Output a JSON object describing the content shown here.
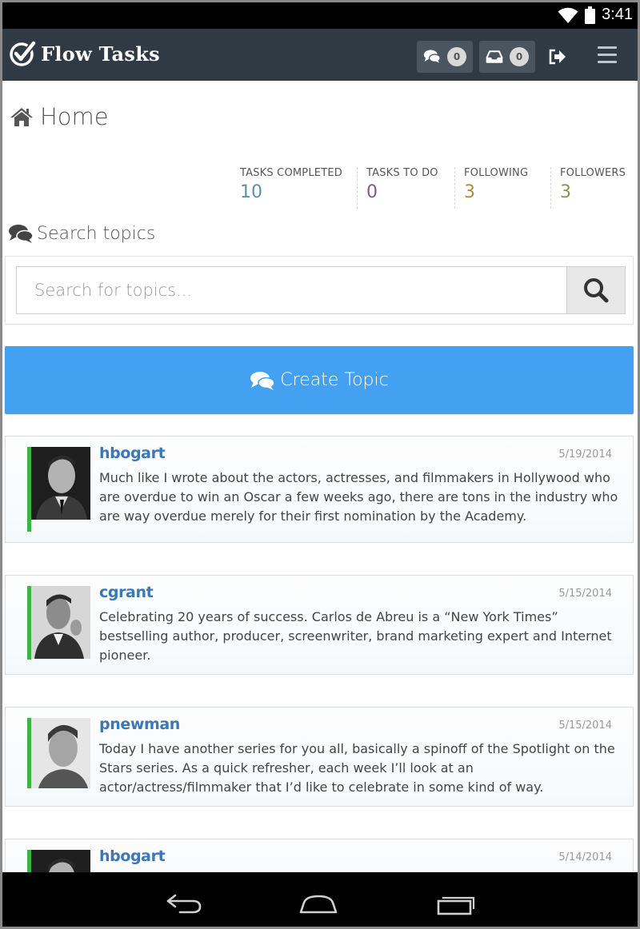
{
  "status_bar": {
    "time": "3:41"
  },
  "app": {
    "name": "Flow Tasks",
    "messages_count": "0",
    "inbox_count": "0"
  },
  "page": {
    "title": "Home"
  },
  "stats": [
    {
      "label": "TASKS COMPLETED",
      "value": "10",
      "color": "#5b8fa8"
    },
    {
      "label": "TASKS TO DO",
      "value": "0",
      "color": "#7a5d8f"
    },
    {
      "label": "FOLLOWING",
      "value": "3",
      "color": "#b08a3e"
    },
    {
      "label": "FOLLOWERS",
      "value": "3",
      "color": "#7f9a4e"
    }
  ],
  "search": {
    "section_title": "Search topics",
    "placeholder": "Search for topics..."
  },
  "create_topic_label": "Create Topic",
  "topics": [
    {
      "user": "hbogart",
      "date": "5/19/2014",
      "text": "Much like I wrote about the actors, actresses, and filmmakers in Hollywood who are overdue to win an Oscar a few weeks ago, there are tons in the industry who are way overdue merely for their first nomination by the Academy."
    },
    {
      "user": "cgrant",
      "date": "5/15/2014",
      "text": "Celebrating 20 years of success. Carlos de Abreu is a “New York Times” bestselling author, producer, screenwriter, brand marketing expert and Internet pioneer."
    },
    {
      "user": "pnewman",
      "date": "5/15/2014",
      "text": "Today I have another series for you all, basically a spinoff of the Spotlight on the Stars series. As a quick refresher, each week I’ll look at an actor/actress/filmmaker that I’d like to celebrate in some kind of way."
    },
    {
      "user": "hbogart",
      "date": "5/14/2014",
      "text": ""
    }
  ],
  "icons": {
    "wifi": "wifi-icon",
    "battery": "battery-icon",
    "logo": "check-circle-icon",
    "messages": "comments-icon",
    "inbox": "inbox-icon",
    "signout": "sign-out-icon",
    "menu": "hamburger-menu-icon",
    "home": "home-icon",
    "search": "search-icon",
    "back": "back-icon",
    "home_nav": "home-nav-icon",
    "recents": "recent-apps-icon"
  }
}
